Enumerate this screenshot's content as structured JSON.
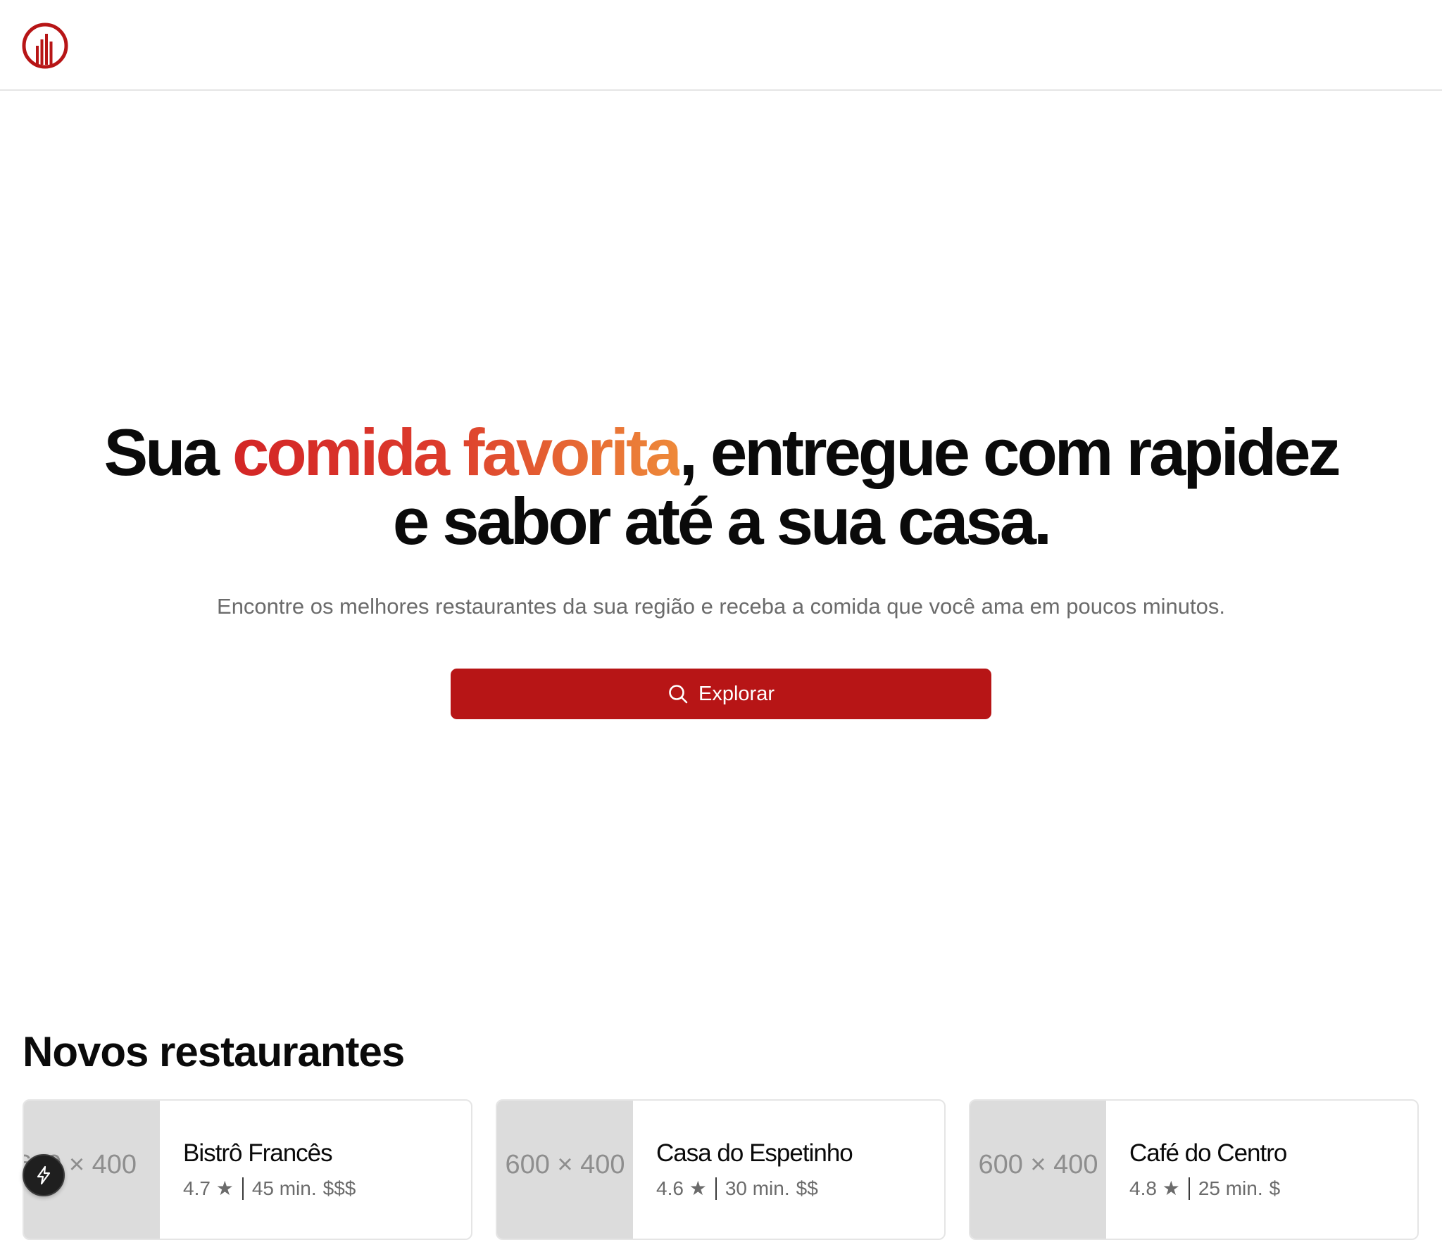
{
  "header": {
    "logo_icon": "bar-chart-circle-logo",
    "brand_color": "#b71516"
  },
  "hero": {
    "title_before": "Sua ",
    "title_highlight": "comida favorita",
    "title_after": ", entregue com rapidez e sabor até a sua casa.",
    "subtitle": "Encontre os melhores restaurantes da sua região e receba a comida que você ama em poucos minutos.",
    "cta_icon": "search-icon",
    "cta_label": "Explorar",
    "highlight_gradient": [
      "#d32626",
      "#ee8a3a"
    ]
  },
  "new_restaurants": {
    "title": "Novos restaurantes",
    "items": [
      {
        "image_placeholder": "600 × 400",
        "name": "Bistrô Francês",
        "rating": "4.7 ★",
        "time": "45 min.",
        "price": "$$$"
      },
      {
        "image_placeholder": "600 × 400",
        "name": "Casa do Espetinho",
        "rating": "4.6 ★",
        "time": "30 min.",
        "price": "$$"
      },
      {
        "image_placeholder": "600 × 400",
        "name": "Café do Centro",
        "rating": "4.8 ★",
        "time": "25 min.",
        "price": "$"
      }
    ]
  },
  "floating_button": {
    "icon": "lightning-icon"
  }
}
